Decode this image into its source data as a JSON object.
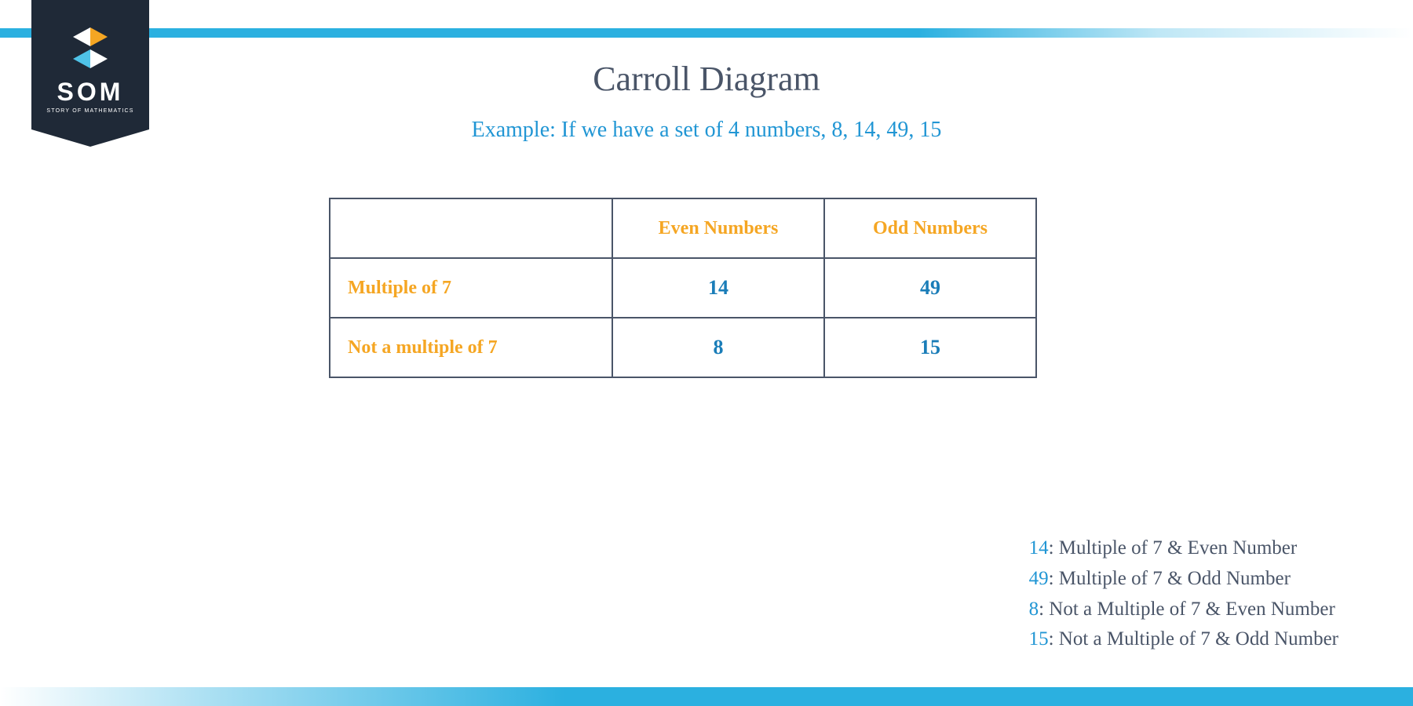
{
  "logo": {
    "text": "SOM",
    "subtext": "STORY OF MATHEMATICS"
  },
  "title": "Carroll Diagram",
  "subtitle": "Example: If we have a set of 4 numbers, 8, 14, 49, 15",
  "chart_data": {
    "type": "table",
    "column_headers": [
      "Even Numbers",
      "Odd Numbers"
    ],
    "row_headers": [
      "Multiple of 7",
      "Not a multiple of 7"
    ],
    "cells": [
      [
        "14",
        "49"
      ],
      [
        "8",
        "15"
      ]
    ]
  },
  "legend": [
    {
      "num": "14",
      "desc": ": Multiple of 7 & Even Number"
    },
    {
      "num": "49",
      "desc": ": Multiple of 7 & Odd Number"
    },
    {
      "num": "8",
      "desc": ": Not a Multiple of 7 & Even Number"
    },
    {
      "num": "15",
      "desc": ": Not a Multiple of 7 & Odd Number"
    }
  ]
}
